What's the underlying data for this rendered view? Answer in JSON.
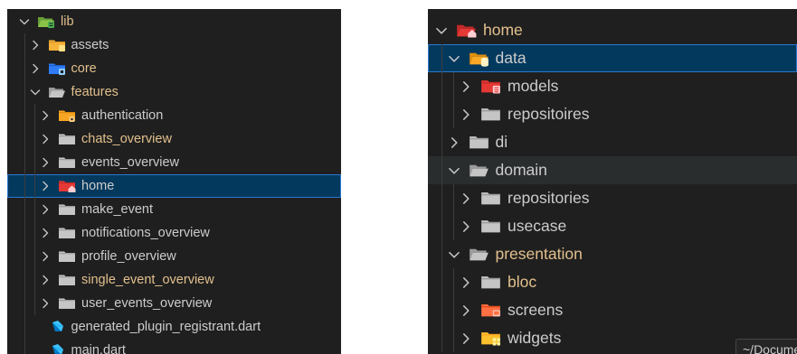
{
  "colors": {
    "background": "#1f1f1f",
    "text": "#cccccc",
    "modified_text": "#e2c08d",
    "selection_bg": "#04395e",
    "selection_border": "#2b79d1",
    "hover_bg": "#2a2d2e"
  },
  "left_explorer": {
    "items": [
      {
        "label": "lib",
        "icon": "lib-folder-open-icon",
        "expanded": true,
        "modified": true
      },
      {
        "label": "assets",
        "icon": "assets-folder-icon",
        "expanded": false,
        "modified": false
      },
      {
        "label": "core",
        "icon": "core-folder-icon",
        "expanded": false,
        "modified": true
      },
      {
        "label": "features",
        "icon": "folder-open-icon",
        "expanded": true,
        "modified": true
      },
      {
        "label": "authentication",
        "icon": "authentication-folder-icon",
        "expanded": false,
        "modified": false
      },
      {
        "label": "chats_overview",
        "icon": "folder-icon",
        "expanded": false,
        "modified": true
      },
      {
        "label": "events_overview",
        "icon": "folder-icon",
        "expanded": false,
        "modified": false
      },
      {
        "label": "home",
        "icon": "home-folder-icon",
        "expanded": false,
        "modified": false,
        "selected": true
      },
      {
        "label": "make_event",
        "icon": "folder-icon",
        "expanded": false,
        "modified": false
      },
      {
        "label": "notifications_overview",
        "icon": "folder-icon",
        "expanded": false,
        "modified": false
      },
      {
        "label": "profile_overview",
        "icon": "folder-icon",
        "expanded": false,
        "modified": false
      },
      {
        "label": "single_event_overview",
        "icon": "folder-icon",
        "expanded": false,
        "modified": true
      },
      {
        "label": "user_events_overview",
        "icon": "folder-icon",
        "expanded": false,
        "modified": false
      },
      {
        "label": "generated_plugin_registrant.dart",
        "icon": "dart-file-icon",
        "modified": false
      },
      {
        "label": "main.dart",
        "icon": "dart-file-icon",
        "modified": false
      }
    ]
  },
  "right_explorer": {
    "items": [
      {
        "label": "home",
        "icon": "home-folder-open-icon",
        "expanded": true,
        "modified": true
      },
      {
        "label": "data",
        "icon": "data-folder-open-icon",
        "expanded": true,
        "modified": false,
        "selected": true
      },
      {
        "label": "models",
        "icon": "models-folder-icon",
        "expanded": false,
        "modified": false
      },
      {
        "label": "repositoires",
        "icon": "folder-icon",
        "expanded": false,
        "modified": false
      },
      {
        "label": "di",
        "icon": "folder-icon",
        "expanded": false,
        "modified": false
      },
      {
        "label": "domain",
        "icon": "folder-open-icon",
        "expanded": true,
        "modified": false,
        "hovered": true
      },
      {
        "label": "repositories",
        "icon": "folder-icon",
        "expanded": false,
        "modified": false
      },
      {
        "label": "usecase",
        "icon": "folder-icon",
        "expanded": false,
        "modified": false
      },
      {
        "label": "presentation",
        "icon": "folder-open-icon",
        "expanded": true,
        "modified": true
      },
      {
        "label": "bloc",
        "icon": "folder-icon",
        "expanded": false,
        "modified": true
      },
      {
        "label": "screens",
        "icon": "screens-folder-icon",
        "expanded": false,
        "modified": false
      },
      {
        "label": "widgets",
        "icon": "widgets-folder-icon",
        "expanded": false,
        "modified": false
      }
    ],
    "tooltip": "~/Documents"
  }
}
